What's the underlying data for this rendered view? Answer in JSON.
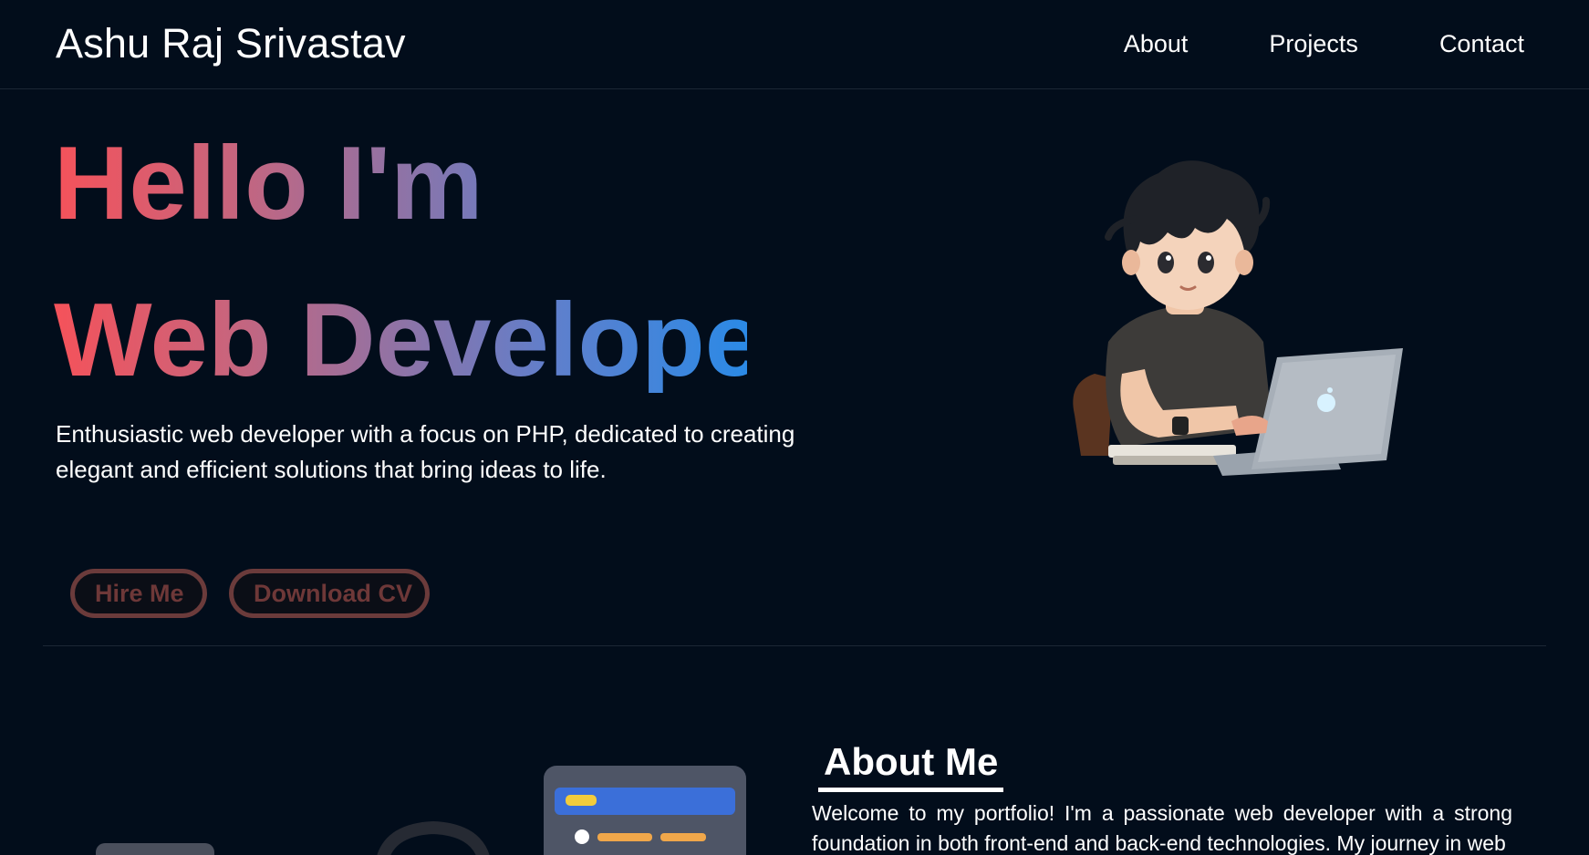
{
  "header": {
    "brand": "Ashu Raj Srivastav",
    "nav": [
      "About",
      "Projects",
      "Contact"
    ]
  },
  "hero": {
    "line1": "Hello I'm",
    "line2": "Web Developer",
    "description": "Enthusiastic web developer with a focus on PHP, dedicated to creating elegant and efficient solutions that bring ideas to life.",
    "buttons": {
      "hire": "Hire Me",
      "cv": "Download CV"
    },
    "gradient": [
      "#f5525a",
      "#8f73a6",
      "#2b8ae6"
    ]
  },
  "about": {
    "title": "About Me",
    "text": "Welcome to my portfolio! I'm a passionate web developer with a strong foundation in both front-end and back-end technologies. My journey in web"
  },
  "colors": {
    "background": "#020d1b",
    "button_border": "#6b3b3b",
    "button_text": "#6e3838"
  }
}
